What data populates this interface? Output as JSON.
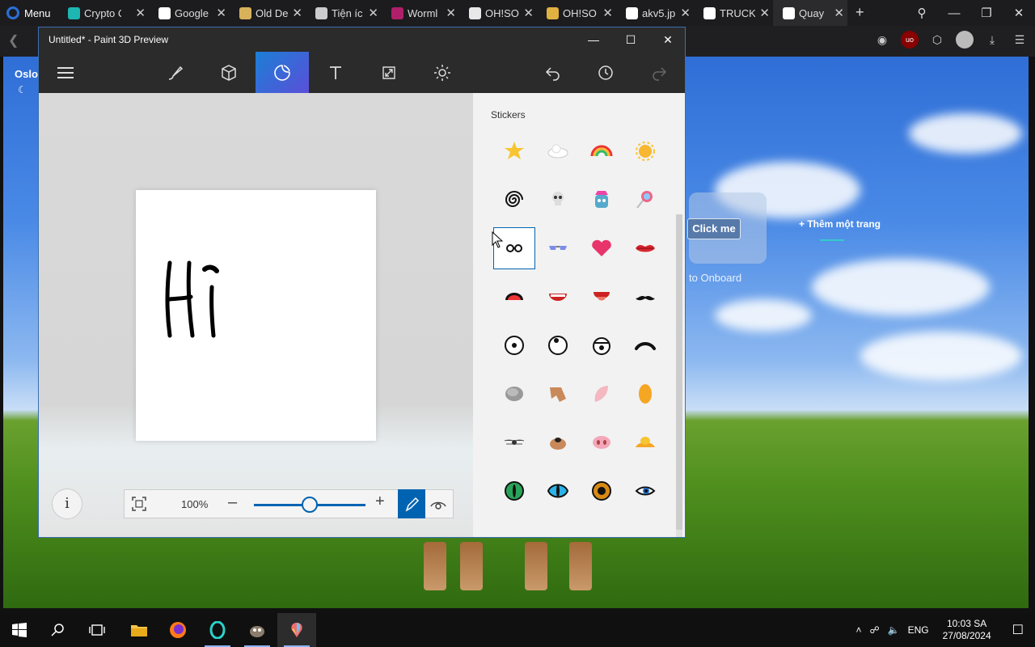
{
  "browser": {
    "menu_label": "Menu",
    "tabs": [
      {
        "title": "Crypto Com",
        "favicon_color": "#1db6b3",
        "active": false
      },
      {
        "title": "Google",
        "favicon_color": "#ffffff",
        "active": false
      },
      {
        "title": "Old De",
        "favicon_color": "#d8b25a",
        "active": false
      },
      {
        "title": "Tiện íc",
        "favicon_color": "#cccccc",
        "active": false
      },
      {
        "title": "Worml",
        "favicon_color": "#b0206a",
        "active": false
      },
      {
        "title": "OH!SO",
        "favicon_color": "#e8e8e8",
        "active": false
      },
      {
        "title": "OH!SO",
        "favicon_color": "#e0b040",
        "active": false
      },
      {
        "title": "akv5.jp",
        "favicon_color": "#ffffff",
        "active": false
      },
      {
        "title": "TRUCK",
        "favicon_color": "#ffffff",
        "active": false
      },
      {
        "title": "Quay",
        "favicon_color": "#ffffff",
        "active": true
      }
    ],
    "new_tab_icon": "plus-icon"
  },
  "page": {
    "weather_city": "Oslo",
    "click_me_label": "Click me",
    "add_page_label": "+ Thêm một trang",
    "onboard_label": "to Onboard"
  },
  "paint3d": {
    "window_title": "Untitled* - Paint 3D Preview",
    "toolbar_tools": [
      "menu",
      "brushes",
      "3d-shapes",
      "stickers",
      "text",
      "effects",
      "canvas",
      "undo",
      "history",
      "redo"
    ],
    "active_tool": "stickers",
    "canvas_text": "Hi",
    "zoom_percent": "100%",
    "zoom_level": 0.5,
    "panel_heading": "Stickers",
    "selected_sticker": "glasses",
    "stickers": [
      "star",
      "cloud",
      "rainbow",
      "sun",
      "spiral",
      "skull",
      "unicorn",
      "lollipop",
      "glasses",
      "sunglasses",
      "heart",
      "lips",
      "mouth-open",
      "mouth-smile",
      "tongue",
      "mustache",
      "eye-round",
      "eye-big",
      "eye-worried",
      "eyebrow",
      "nose-gray",
      "ear-dog",
      "ear-pink",
      "ear-orange",
      "nose-mouse",
      "nose-dog",
      "nose-pig",
      "nose-duck",
      "eye-cat-green",
      "eye-cat-blue",
      "eye-orange",
      "eye-lash"
    ]
  },
  "taskbar": {
    "language": "ENG",
    "time": "10:03 SA",
    "date": "27/08/2024"
  }
}
